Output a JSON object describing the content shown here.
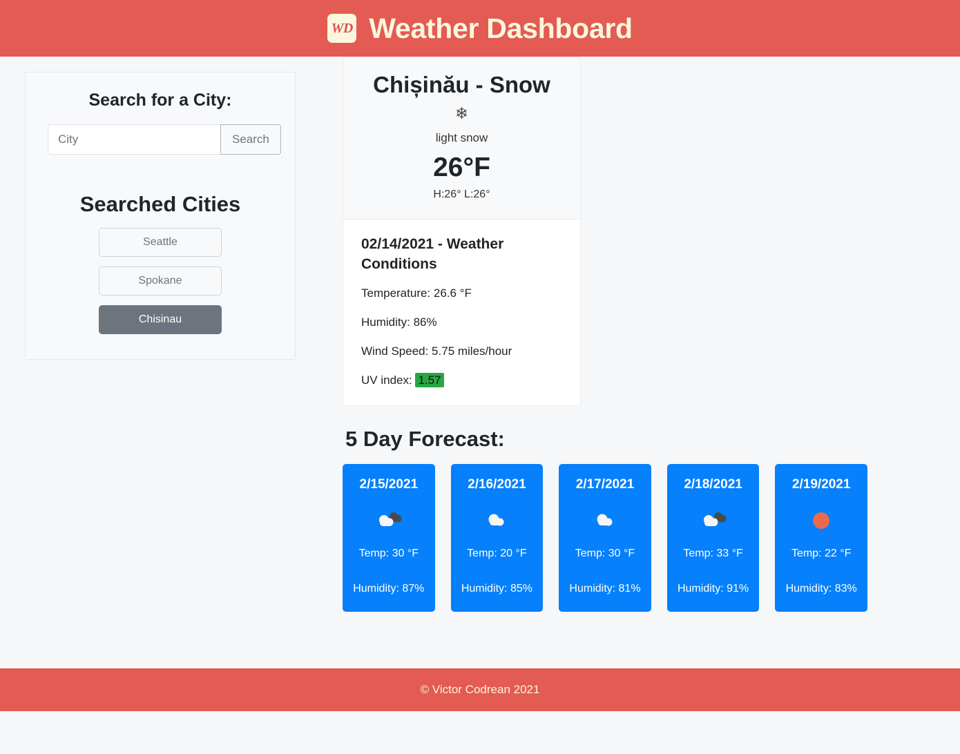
{
  "header": {
    "logo_text": "WD",
    "title": "Weather Dashboard",
    "background_color": "#e35b52",
    "text_color": "#fbf6dd"
  },
  "sidebar": {
    "search_heading": "Search for a City:",
    "search_placeholder": "City",
    "search_value": "",
    "search_button_label": "Search",
    "searched_heading": "Searched Cities",
    "cities": [
      {
        "label": "Seattle",
        "active": false
      },
      {
        "label": "Spokane",
        "active": false
      },
      {
        "label": "Chisinau",
        "active": true
      }
    ],
    "active_color": "#6c757d"
  },
  "current": {
    "title": "Chișinău - Snow",
    "icon": "snowflake-icon",
    "icon_glyph": "❄",
    "description": "light snow",
    "temperature": "26°F",
    "high_low": "H:26° L:26°"
  },
  "conditions": {
    "heading": "02/14/2021 - Weather Conditions",
    "temperature": "Temperature: 26.6 °F",
    "humidity": "Humidity: 86%",
    "wind_speed": "Wind Speed: 5.75 miles/hour",
    "uv_label": "UV index:",
    "uv_value": "1.57",
    "uv_color": "#28a745"
  },
  "forecast": {
    "heading": "5 Day Forecast:",
    "card_color": "#0680fb",
    "days": [
      {
        "date": "2/15/2021",
        "icon": "broken-clouds-icon",
        "temp": "Temp: 30 °F",
        "humidity": "Humidity: 87%"
      },
      {
        "date": "2/16/2021",
        "icon": "cloud-icon",
        "temp": "Temp: 20 °F",
        "humidity": "Humidity: 85%"
      },
      {
        "date": "2/17/2021",
        "icon": "cloud-icon",
        "temp": "Temp: 30 °F",
        "humidity": "Humidity: 81%"
      },
      {
        "date": "2/18/2021",
        "icon": "broken-clouds-icon",
        "temp": "Temp: 33 °F",
        "humidity": "Humidity: 91%"
      },
      {
        "date": "2/19/2021",
        "icon": "sun-icon",
        "temp": "Temp: 22 °F",
        "humidity": "Humidity: 83%"
      }
    ]
  },
  "footer": {
    "copyright": "© Victor Codrean 2021"
  }
}
